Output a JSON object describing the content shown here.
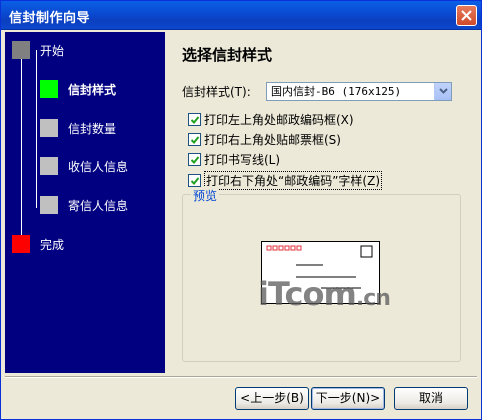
{
  "window": {
    "title": "信封制作向导"
  },
  "nav": {
    "steps": [
      {
        "label": "开始",
        "color": "#808080",
        "state": "done"
      },
      {
        "label": "信封样式",
        "color": "#00ff00",
        "state": "current"
      },
      {
        "label": "信封数量",
        "color": "#c0c0c0",
        "state": "pending"
      },
      {
        "label": "收信人信息",
        "color": "#c0c0c0",
        "state": "pending"
      },
      {
        "label": "寄信人信息",
        "color": "#c0c0c0",
        "state": "pending"
      },
      {
        "label": "完成",
        "color": "#ff0000",
        "state": "pending"
      }
    ]
  },
  "content": {
    "heading": "选择信封样式",
    "style_label": "信封样式(T):",
    "style_value": "国内信封-B6 (176x125)",
    "options": [
      {
        "label": "打印左上角处邮政编码框(X)",
        "checked": true
      },
      {
        "label": "打印右上角处贴邮票框(S)",
        "checked": true
      },
      {
        "label": "打印书写线(L)",
        "checked": true
      },
      {
        "label": "打印右下角处“邮政编码”字样(Z)",
        "checked": true
      }
    ],
    "preview_label": "预览",
    "watermark": {
      "main": "iTcom",
      "suffix": ".cn"
    }
  },
  "buttons": {
    "back": "<上一步(B)",
    "next": "下一步(N)>",
    "cancel": "取消"
  },
  "colors": {
    "nav_bg": "#000080",
    "title_bar": "#0a4ad1",
    "accent": "#0046d5"
  }
}
